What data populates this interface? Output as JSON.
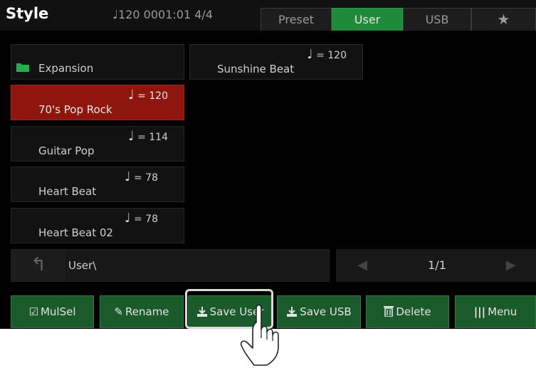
{
  "header": {
    "title": "Style",
    "tempo_note": "♩",
    "tempo_info": "120  0001:01  4/4",
    "tabs": [
      {
        "label": "Preset"
      },
      {
        "label": "User"
      },
      {
        "label": "USB"
      },
      {
        "label": "★"
      }
    ]
  },
  "items": [
    {
      "name": "Expansion",
      "type": "folder"
    },
    {
      "name": "70's Pop Rock",
      "tempo": "= 120",
      "selected": true
    },
    {
      "name": "Guitar Pop",
      "tempo": "= 114"
    },
    {
      "name": "Heart Beat",
      "tempo": "= 78"
    },
    {
      "name": "Heart Beat 02",
      "tempo": "= 78"
    },
    {
      "name": "Sunshine Beat",
      "tempo": "= 120"
    }
  ],
  "note_glyph": "♩",
  "path": "User\\",
  "pager": {
    "page": "1/1",
    "prev": "◀",
    "next": "▶"
  },
  "buttons": {
    "mulsel": "MulSel",
    "rename": "Rename",
    "save_user": "Save User",
    "save_usb": "Save USB",
    "delete": "Delete",
    "menu": "Menu"
  },
  "icons": {
    "back": "↰",
    "mulsel": "☑",
    "rename": "✎",
    "delete": "🗑",
    "menu": "|||"
  },
  "colors": {
    "active_tab": "#1f8a3a",
    "selected_item": "#8e160c",
    "button_green": "#1b5a2b",
    "folder": "#23b04a"
  }
}
